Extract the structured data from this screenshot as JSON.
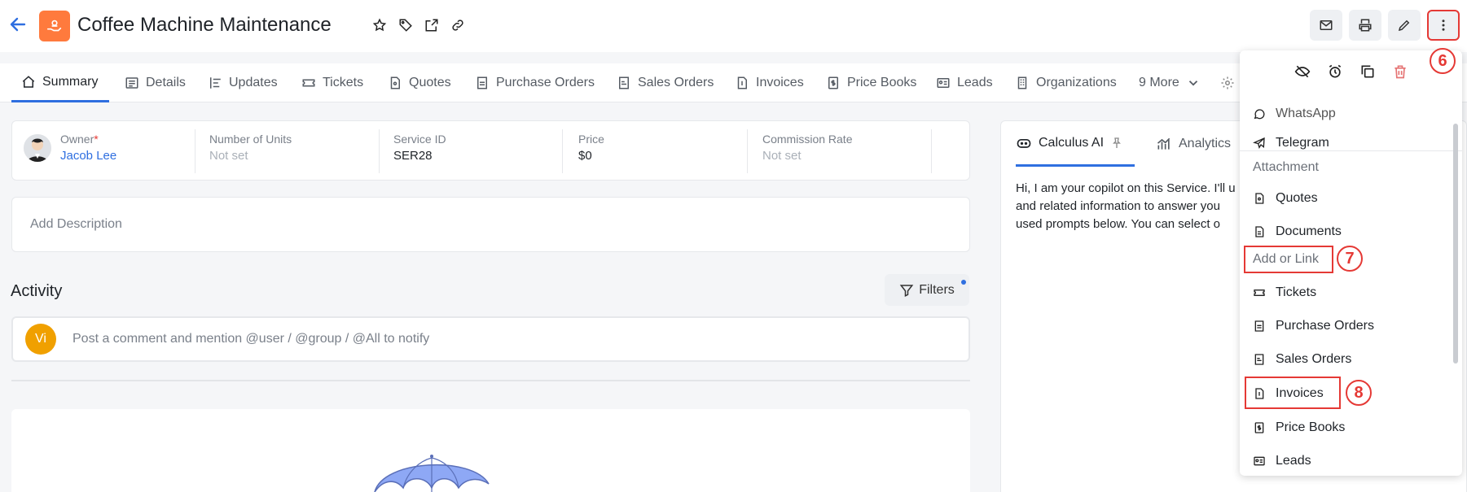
{
  "header": {
    "title": "Coffee Machine Maintenance",
    "actions": [
      "email-icon",
      "print-icon",
      "pencil-icon",
      "more-vertical-icon"
    ]
  },
  "tabs": [
    {
      "label": "Summary",
      "icon": "home-icon",
      "active": true
    },
    {
      "label": "Details",
      "icon": "list-icon"
    },
    {
      "label": "Updates",
      "icon": "updates-icon"
    },
    {
      "label": "Tickets",
      "icon": "ticket-icon"
    },
    {
      "label": "Quotes",
      "icon": "quote-icon"
    },
    {
      "label": "Purchase Orders",
      "icon": "purchase-order-icon"
    },
    {
      "label": "Sales Orders",
      "icon": "sales-order-icon"
    },
    {
      "label": "Invoices",
      "icon": "invoice-icon"
    },
    {
      "label": "Price Books",
      "icon": "price-book-icon"
    },
    {
      "label": "Leads",
      "icon": "lead-icon"
    },
    {
      "label": "Organizations",
      "icon": "organization-icon"
    },
    {
      "label": "9 More",
      "icon": "chevron-down-icon"
    }
  ],
  "fields": [
    {
      "label": "Owner",
      "required": "*",
      "value": "Jacob Lee"
    },
    {
      "label": "Number of Units",
      "value": "Not set"
    },
    {
      "label": "Service ID",
      "value": "SER28"
    },
    {
      "label": "Price",
      "value": "$0"
    },
    {
      "label": "Commission Rate",
      "value": "Not set"
    }
  ],
  "description": {
    "placeholder": "Add Description"
  },
  "activity": {
    "title": "Activity",
    "filters_label": "Filters",
    "avatar_initials": "Vi",
    "comment_placeholder": "Post a comment and mention @user / @group / @All to notify"
  },
  "right_panel": {
    "tabs": [
      "Calculus AI",
      "Analytics"
    ],
    "text_lines": [
      "Hi, I am your copilot on this Service. I'll u",
      "and related information to answer you",
      "used prompts below. You can select o"
    ]
  },
  "menu": {
    "top_actions": [
      "eye-off-icon",
      "alarm-icon",
      "copy-icon",
      "trash-icon"
    ],
    "items": [
      {
        "label": "WhatsApp",
        "icon": "whatsapp-icon"
      },
      {
        "label": "Telegram",
        "icon": "telegram-icon"
      },
      {
        "section": "Attachment"
      },
      {
        "label": "Quotes",
        "icon": "quote-icon"
      },
      {
        "label": "Documents",
        "icon": "document-icon"
      },
      {
        "section": "Add or Link"
      },
      {
        "label": "Tickets",
        "icon": "ticket-icon"
      },
      {
        "label": "Purchase Orders",
        "icon": "purchase-order-icon"
      },
      {
        "label": "Sales Orders",
        "icon": "sales-order-icon"
      },
      {
        "label": "Invoices",
        "icon": "invoice-icon"
      },
      {
        "label": "Price Books",
        "icon": "price-book-icon"
      },
      {
        "label": "Leads",
        "icon": "lead-icon"
      }
    ]
  },
  "annotations": [
    "6",
    "7",
    "8"
  ],
  "colors": {
    "accent": "#2f6fe0",
    "annotation": "#e53935",
    "app_icon": "#ff7a3d",
    "avatar": "#f0a000"
  }
}
